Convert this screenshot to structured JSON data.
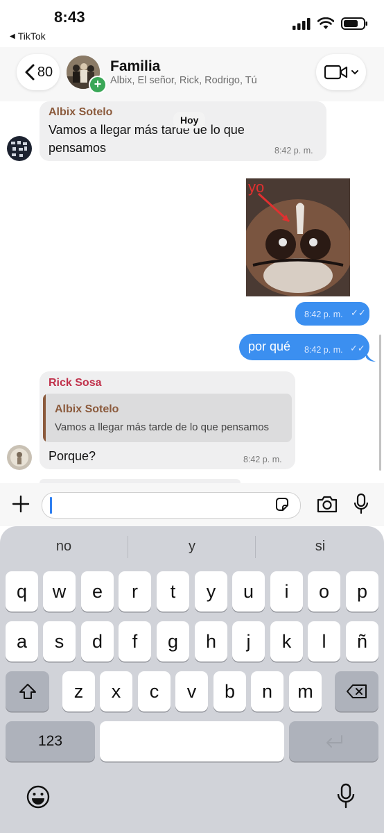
{
  "status_bar": {
    "time": "8:43",
    "back_app": "TikTok",
    "icons": [
      "signal-icon",
      "wifi-icon",
      "battery-icon"
    ]
  },
  "header": {
    "back_count": "80",
    "title": "Familia",
    "members": "Albix, El señor, Rick, Rodrigo, Tú",
    "video_icon": "video-camera-icon"
  },
  "day_label": "Hoy",
  "messages": [
    {
      "sender": "Albix Sotelo",
      "sender_color": "#8b5a3c",
      "text_line1": "Vamos a llegar más tarde de lo que",
      "text_line2": "pensamos",
      "time": "8:42 p. m."
    },
    {
      "image_caption": "yo",
      "time": "8:42 p. m."
    },
    {
      "text": "por qué",
      "time": "8:42 p. m."
    },
    {
      "sender": "Rick Sosa",
      "sender_color": "#c0304a",
      "reply_sender": "Albix Sotelo",
      "reply_text": "Vamos a llegar más tarde de lo que pensamos",
      "text": "Porque?",
      "time": "8:42 p. m."
    }
  ],
  "input": {
    "value": "",
    "icons": [
      "plus-icon",
      "sticker-icon",
      "camera-icon",
      "microphone-icon"
    ]
  },
  "keyboard": {
    "suggestions": [
      "no",
      "y",
      "si"
    ],
    "row1": [
      "q",
      "w",
      "e",
      "r",
      "t",
      "y",
      "u",
      "i",
      "o",
      "p"
    ],
    "row2": [
      "a",
      "s",
      "d",
      "f",
      "g",
      "h",
      "j",
      "k",
      "l",
      "ñ"
    ],
    "row3": [
      "z",
      "x",
      "c",
      "v",
      "b",
      "n",
      "m"
    ],
    "numbers_label": "123"
  },
  "colors": {
    "accent": "#3b8ff0",
    "incoming_bubble": "#efeff0",
    "keyboard_bg": "#d1d3d9"
  }
}
